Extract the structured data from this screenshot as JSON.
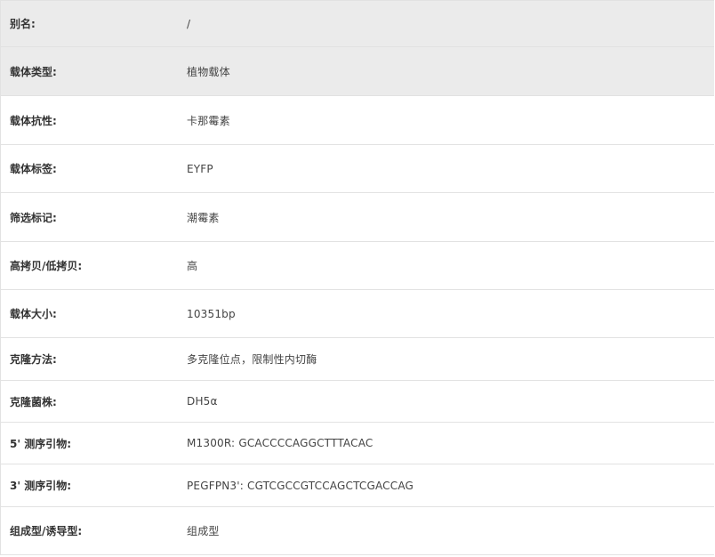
{
  "rows": [
    {
      "label": "别名:",
      "value": "/"
    },
    {
      "label": "载体类型:",
      "value": "植物载体"
    },
    {
      "label": "载体抗性:",
      "value": "卡那霉素"
    },
    {
      "label": "载体标签:",
      "value": "EYFP"
    },
    {
      "label": "筛选标记:",
      "value": "潮霉素"
    },
    {
      "label": "高拷贝/低拷贝:",
      "value": "高"
    },
    {
      "label": "载体大小:",
      "value": "10351bp"
    },
    {
      "label": "克隆方法:",
      "value": "多克隆位点，限制性内切酶"
    },
    {
      "label": "克隆菌株:",
      "value": "DH5α"
    },
    {
      "label": "5' 测序引物:",
      "value": "M1300R: GCACCCCAGGCTTTACAC"
    },
    {
      "label": "3' 测序引物:",
      "value": "PEGFPN3': CGTCGCCGTCCAGCTCGACCAG"
    },
    {
      "label": "组成型/诱导型:",
      "value": "组成型"
    }
  ]
}
